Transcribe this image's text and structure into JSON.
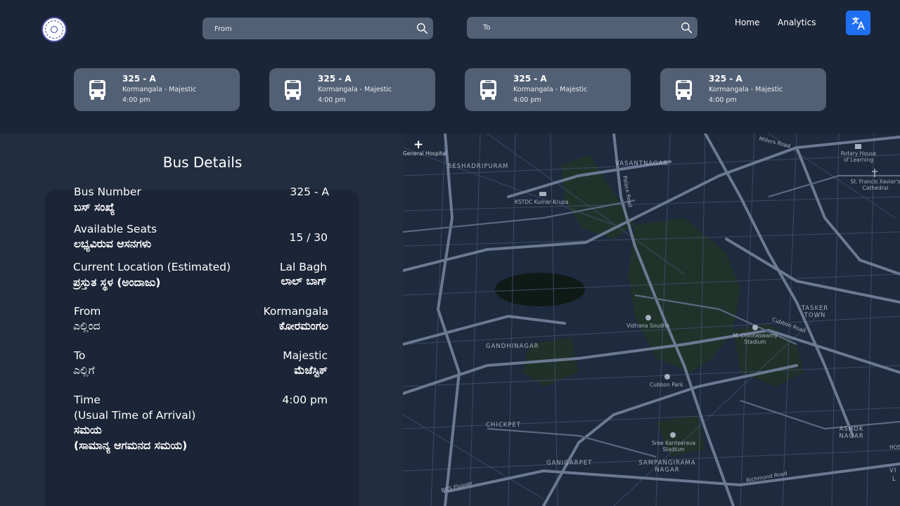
{
  "header": {
    "search_from": {
      "placeholder": "From"
    },
    "search_to": {
      "placeholder": "To"
    },
    "nav": {
      "home": "Home",
      "analytics": "Analytics"
    }
  },
  "bus_cards": [
    {
      "number": "325 - A",
      "route": "Kormangala - Majestic",
      "time": "4:00 pm"
    },
    {
      "number": "325 - A",
      "route": "Kormangala - Majestic",
      "time": "4:00 pm"
    },
    {
      "number": "325 - A",
      "route": "Kormangala - Majestic",
      "time": "4:00 pm"
    },
    {
      "number": "325 - A",
      "route": "Kormangala - Majestic",
      "time": "4:00 pm"
    }
  ],
  "details": {
    "title": "Bus Details",
    "bus_number": {
      "label_en": "Bus Number",
      "label_kn": "ಬಸ್ ಸಂಖ್ಯೆ",
      "value": "325 - A"
    },
    "seats": {
      "label_en": "Available Seats",
      "label_kn": "ಲಭ್ಯವಿರುವ ಆಸನಗಳು",
      "value": "15 / 30"
    },
    "location": {
      "label_en": "Current Location (Estimated)",
      "label_kn": "ಪ್ರಸ್ತುತ ಸ್ಥಳ (ಅಂದಾಜು)",
      "value_en": "Lal Bagh",
      "value_kn": "ಲಾಲ್ ಬಾಗ್"
    },
    "from": {
      "label_en": "From",
      "label_kn": "ಎಲ್ಲಿಂದ",
      "value_en": "Kormangala",
      "value_kn": "ಕೋರಮಂಗಲ"
    },
    "to": {
      "label_en": "To",
      "label_kn": "ಎಲ್ಲಿಗೆ",
      "value_en": "Majestic",
      "value_kn": "ಮೆಜೆಸ್ಟಿಕ್"
    },
    "time": {
      "label_en": "Time",
      "label_en_sub": "(Usual Time of Arrival)",
      "label_kn": "ಸಮಯ",
      "label_kn_sub": "(ಸಾಮಾನ್ಯ ಆಗಮನದ ಸಮಯ)",
      "value": "4:00 pm"
    }
  },
  "map": {
    "zoom_in": "+",
    "labels": {
      "general_hospital": "General Hospital",
      "seshadripuram": "SESHADRIPURAM",
      "vasantnagar": "VASANTNAGAR",
      "millers_road": "Millers Road",
      "rotary_house": "Rotary House of Learning",
      "st_francis": "St. Francis Xavier's Cathedral",
      "kstdc": "KSTDC Kumar Krupa",
      "palace_road": "Palace Road",
      "tasker_town": "TASKER TOWN",
      "cubbon_road": "Cubbon Road",
      "vidhana_soudha": "Vidhana Soudha",
      "chinnaswamy": "M. Chinnaswamy Stadium",
      "gandhinagar": "GANDHINAGAR",
      "cubbon_park": "Cubbon Park",
      "chickpet": "CHICKPET",
      "kanteerava": "Sree Kanteerava Stadium",
      "ashok_nagar": "ASHOK NAGAR",
      "ganigarpet": "GANIGARPET",
      "sampangirama": "SAMPANGIRAMA NAGAR",
      "richmond_road": "Richmond Road",
      "bgs_flyover": "BGS Flyover",
      "hos": "HOS",
      "vi": "VI",
      "l": "L"
    }
  }
}
